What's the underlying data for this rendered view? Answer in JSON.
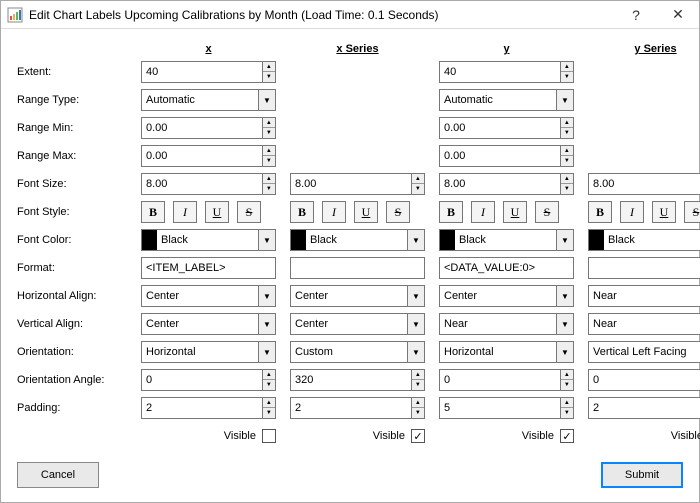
{
  "window": {
    "title": "Edit Chart Labels Upcoming Calibrations by Month (Load Time: 0.1 Seconds)",
    "help": "?",
    "close": "✕"
  },
  "columns": {
    "x": "x",
    "xs": "x Series",
    "y": "y",
    "ys": "y Series"
  },
  "rows": {
    "extent": "Extent:",
    "rangeType": "Range Type:",
    "rangeMin": "Range Min:",
    "rangeMax": "Range Max:",
    "fontSize": "Font Size:",
    "fontStyle": "Font Style:",
    "fontColor": "Font Color:",
    "format": "Format:",
    "hAlign": "Horizontal Align:",
    "vAlign": "Vertical Align:",
    "orientation": "Orientation:",
    "orientAngle": "Orientation Angle:",
    "padding": "Padding:",
    "visibleLabel": "Visible"
  },
  "glyphs": {
    "b": "B",
    "i": "I",
    "u": "U",
    "s": "S",
    "check": "✓"
  },
  "vals": {
    "extent": {
      "x": "40",
      "y": "40"
    },
    "rangeType": {
      "x": "Automatic",
      "y": "Automatic"
    },
    "rangeMin": {
      "x": "0.00",
      "y": "0.00"
    },
    "rangeMax": {
      "x": "0.00",
      "y": "0.00"
    },
    "fontSize": {
      "x": "8.00",
      "xs": "8.00",
      "y": "8.00",
      "ys": "8.00"
    },
    "fontColor": {
      "x": "Black",
      "xs": "Black",
      "y": "Black",
      "ys": "Black"
    },
    "format": {
      "x": "<ITEM_LABEL>",
      "xs": "",
      "y": "<DATA_VALUE:0>",
      "ys": ""
    },
    "hAlign": {
      "x": "Center",
      "xs": "Center",
      "y": "Center",
      "ys": "Near"
    },
    "vAlign": {
      "x": "Center",
      "xs": "Center",
      "y": "Near",
      "ys": "Near"
    },
    "orientation": {
      "x": "Horizontal",
      "xs": "Custom",
      "y": "Horizontal",
      "ys": "Vertical Left Facing"
    },
    "orientAngle": {
      "x": "0",
      "xs": "320",
      "y": "0",
      "ys": "0"
    },
    "padding": {
      "x": "2",
      "xs": "2",
      "y": "5",
      "ys": "2"
    },
    "visible": {
      "x": false,
      "xs": true,
      "y": true,
      "ys": false
    }
  },
  "buttons": {
    "cancel": "Cancel",
    "submit": "Submit"
  }
}
